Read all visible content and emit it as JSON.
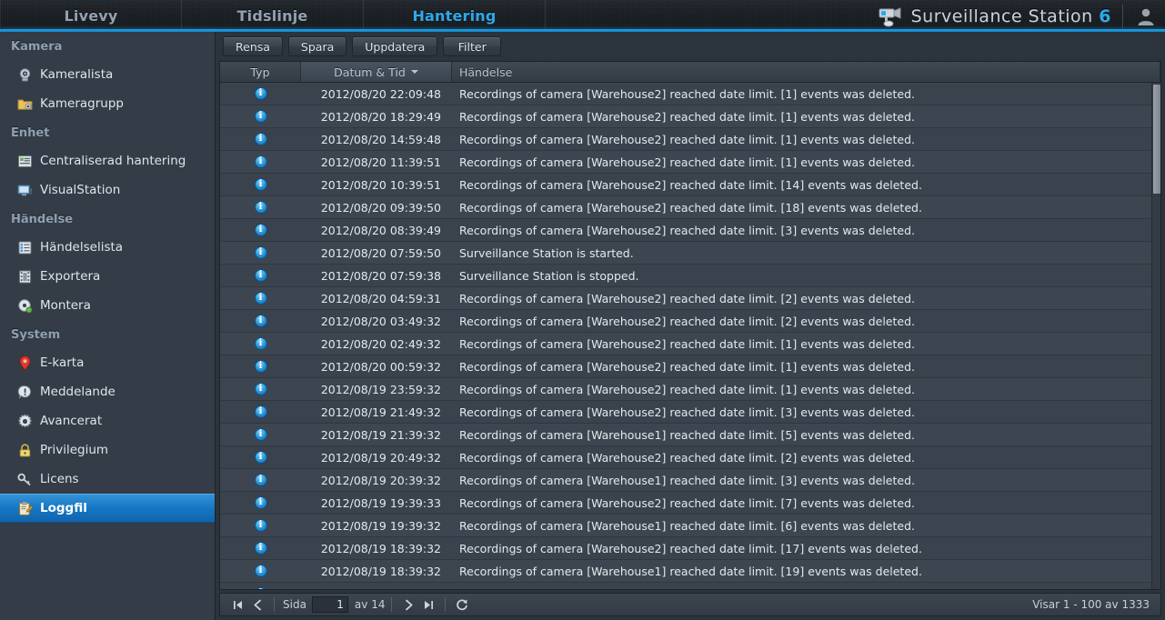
{
  "topbar": {
    "tabs": [
      {
        "label": "Livevy",
        "active": false
      },
      {
        "label": "Tidslinje",
        "active": false
      },
      {
        "label": "Hantering",
        "active": true
      }
    ],
    "brand_name": "Surveillance Station",
    "brand_version": "6",
    "brand_icon": "camera-icon",
    "user_icon": "user-avatar-icon"
  },
  "sidebar": {
    "groups": [
      {
        "title": "Kamera",
        "items": [
          {
            "label": "Kameralista",
            "icon": "camera-icon",
            "selected": false
          },
          {
            "label": "Kameragrupp",
            "icon": "folder-camera-icon",
            "selected": false
          }
        ]
      },
      {
        "title": "Enhet",
        "items": [
          {
            "label": "Centraliserad hantering",
            "icon": "server-list-icon",
            "selected": false
          },
          {
            "label": "VisualStation",
            "icon": "monitor-icon",
            "selected": false
          }
        ]
      },
      {
        "title": "Händelse",
        "items": [
          {
            "label": "Händelselista",
            "icon": "list-icon",
            "selected": false
          },
          {
            "label": "Exportera",
            "icon": "filmstrip-icon",
            "selected": false
          },
          {
            "label": "Montera",
            "icon": "disc-icon",
            "selected": false
          }
        ]
      },
      {
        "title": "System",
        "items": [
          {
            "label": "E-karta",
            "icon": "map-pin-icon",
            "selected": false
          },
          {
            "label": "Meddelande",
            "icon": "notification-icon",
            "selected": false
          },
          {
            "label": "Avancerat",
            "icon": "gear-icon",
            "selected": false
          },
          {
            "label": "Privilegium",
            "icon": "lock-icon",
            "selected": false
          },
          {
            "label": "Licens",
            "icon": "key-icon",
            "selected": false
          },
          {
            "label": "Loggfil",
            "icon": "clipboard-pencil-icon",
            "selected": true
          }
        ]
      }
    ]
  },
  "toolbar": {
    "buttons": [
      {
        "label": "Rensa",
        "name": "clear-button"
      },
      {
        "label": "Spara",
        "name": "save-button"
      },
      {
        "label": "Uppdatera",
        "name": "refresh-button"
      },
      {
        "label": "Filter",
        "name": "filter-button"
      }
    ]
  },
  "grid": {
    "columns": [
      {
        "label": "Typ",
        "name": "column-type",
        "sorted": false
      },
      {
        "label": "Datum & Tid",
        "name": "column-datetime",
        "sorted": true,
        "sort_dir": "desc"
      },
      {
        "label": "Händelse",
        "name": "column-event",
        "sorted": false
      }
    ],
    "rows": [
      {
        "type": "info",
        "datetime": "2012/08/20 22:09:48",
        "event": "Recordings of camera [Warehouse2] reached date limit. [1] events was deleted."
      },
      {
        "type": "info",
        "datetime": "2012/08/20 18:29:49",
        "event": "Recordings of camera [Warehouse2] reached date limit. [1] events was deleted."
      },
      {
        "type": "info",
        "datetime": "2012/08/20 14:59:48",
        "event": "Recordings of camera [Warehouse2] reached date limit. [1] events was deleted."
      },
      {
        "type": "info",
        "datetime": "2012/08/20 11:39:51",
        "event": "Recordings of camera [Warehouse2] reached date limit. [1] events was deleted."
      },
      {
        "type": "info",
        "datetime": "2012/08/20 10:39:51",
        "event": "Recordings of camera [Warehouse2] reached date limit. [14] events was deleted."
      },
      {
        "type": "info",
        "datetime": "2012/08/20 09:39:50",
        "event": "Recordings of camera [Warehouse2] reached date limit. [18] events was deleted."
      },
      {
        "type": "info",
        "datetime": "2012/08/20 08:39:49",
        "event": "Recordings of camera [Warehouse2] reached date limit. [3] events was deleted."
      },
      {
        "type": "info",
        "datetime": "2012/08/20 07:59:50",
        "event": "Surveillance Station is started."
      },
      {
        "type": "info",
        "datetime": "2012/08/20 07:59:38",
        "event": "Surveillance Station is stopped."
      },
      {
        "type": "info",
        "datetime": "2012/08/20 04:59:31",
        "event": "Recordings of camera [Warehouse2] reached date limit. [2] events was deleted."
      },
      {
        "type": "info",
        "datetime": "2012/08/20 03:49:32",
        "event": "Recordings of camera [Warehouse2] reached date limit. [2] events was deleted."
      },
      {
        "type": "info",
        "datetime": "2012/08/20 02:49:32",
        "event": "Recordings of camera [Warehouse2] reached date limit. [1] events was deleted."
      },
      {
        "type": "info",
        "datetime": "2012/08/20 00:59:32",
        "event": "Recordings of camera [Warehouse2] reached date limit. [1] events was deleted."
      },
      {
        "type": "info",
        "datetime": "2012/08/19 23:59:32",
        "event": "Recordings of camera [Warehouse2] reached date limit. [1] events was deleted."
      },
      {
        "type": "info",
        "datetime": "2012/08/19 21:49:32",
        "event": "Recordings of camera [Warehouse2] reached date limit. [3] events was deleted."
      },
      {
        "type": "info",
        "datetime": "2012/08/19 21:39:32",
        "event": "Recordings of camera [Warehouse1] reached date limit. [5] events was deleted."
      },
      {
        "type": "info",
        "datetime": "2012/08/19 20:49:32",
        "event": "Recordings of camera [Warehouse2] reached date limit. [2] events was deleted."
      },
      {
        "type": "info",
        "datetime": "2012/08/19 20:39:32",
        "event": "Recordings of camera [Warehouse1] reached date limit. [3] events was deleted."
      },
      {
        "type": "info",
        "datetime": "2012/08/19 19:39:33",
        "event": "Recordings of camera [Warehouse2] reached date limit. [7] events was deleted."
      },
      {
        "type": "info",
        "datetime": "2012/08/19 19:39:32",
        "event": "Recordings of camera [Warehouse1] reached date limit. [6] events was deleted."
      },
      {
        "type": "info",
        "datetime": "2012/08/19 18:39:32",
        "event": "Recordings of camera [Warehouse2] reached date limit. [17] events was deleted."
      },
      {
        "type": "info",
        "datetime": "2012/08/19 18:39:32",
        "event": "Recordings of camera [Warehouse1] reached date limit. [19] events was deleted."
      },
      {
        "type": "info",
        "datetime": "",
        "event": ""
      }
    ]
  },
  "pager": {
    "first_icon": "first-page-icon",
    "prev_icon": "prev-page-icon",
    "next_icon": "next-page-icon",
    "last_icon": "last-page-icon",
    "reload_icon": "reload-icon",
    "page_label": "Sida",
    "page_value": "1",
    "of_label": "av 14",
    "status": "Visar 1 - 100 av 1333"
  },
  "colors": {
    "accent": "#2fa8ea",
    "selected_row": "#1677c4",
    "panel_bg": "#2b333c",
    "sidebar_bg": "#333c47"
  }
}
